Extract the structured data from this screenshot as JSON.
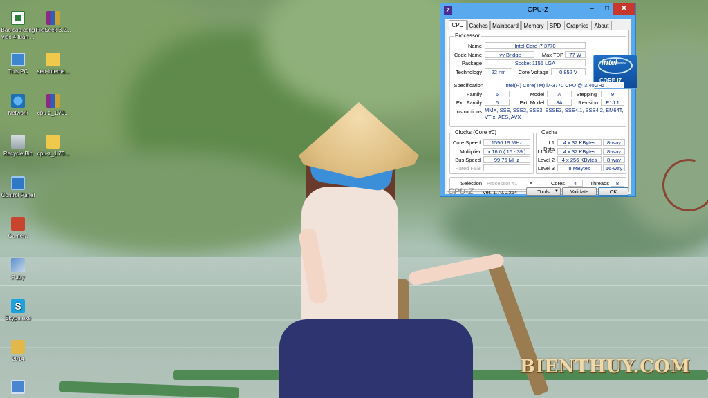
{
  "desktop": {
    "icons": [
      {
        "label": "Bao cao cong viec 4 tuan ...",
        "icon": "excel-document-icon"
      },
      {
        "label": "FileSeek 3.2...",
        "icon": "winrar-archive-icon"
      },
      {
        "label": "This PC",
        "icon": "this-pc-icon"
      },
      {
        "label": "seo-interna...",
        "icon": "folder-icon"
      },
      {
        "label": "Network",
        "icon": "network-icon"
      },
      {
        "label": "cpu-z_1.70...",
        "icon": "winrar-archive-icon"
      },
      {
        "label": "Recycle Bin",
        "icon": "recycle-bin-icon"
      },
      {
        "label": "cpu-z_1.70...",
        "icon": "folder-icon"
      },
      {
        "label": "Control Panel",
        "icon": "control-panel-icon"
      },
      {
        "label": "Camera",
        "icon": "camera-icon"
      },
      {
        "label": "Putty",
        "icon": "putty-icon"
      },
      {
        "label": "Skype.exe",
        "icon": "skype-icon"
      },
      {
        "label": "2014",
        "icon": "folder-icon"
      },
      {
        "label": "",
        "icon": "setup-icon"
      }
    ]
  },
  "wallpaper": {
    "watermark": "BIENTHUY.COM"
  },
  "cpuz": {
    "title": "CPU-Z",
    "app_icon": "Z",
    "window_buttons": {
      "minimize": "–",
      "maximize": "□",
      "close": "✕"
    },
    "tabs": [
      "CPU",
      "Caches",
      "Mainboard",
      "Memory",
      "SPD",
      "Graphics",
      "About"
    ],
    "active_tab": "CPU",
    "processor": {
      "group": "Processor",
      "name_label": "Name",
      "name": "Intel Core i7 3770",
      "codename_label": "Code Name",
      "codename": "Ivy Bridge",
      "max_tdp_label": "Max TDP",
      "max_tdp": "77 W",
      "package_label": "Package",
      "package": "Socket 1155 LGA",
      "technology_label": "Technology",
      "technology": "22 nm",
      "core_voltage_label": "Core Voltage",
      "core_voltage": "0.852 V",
      "specification_label": "Specification",
      "specification": "Intel(R) Core(TM) i7-3770 CPU @ 3.40GHz",
      "family_label": "Family",
      "family": "6",
      "model_label": "Model",
      "model": "A",
      "stepping_label": "Stepping",
      "stepping": "9",
      "ext_family_label": "Ext. Family",
      "ext_family": "6",
      "ext_model_label": "Ext. Model",
      "ext_model": "3A",
      "revision_label": "Revision",
      "revision": "E1/L1",
      "instructions_label": "Instructions",
      "instructions_line1": "MMX, SSE, SSE2, SSE3, SSSE3, SSE4.1, SSE4.2, EM64T,",
      "instructions_line2": "VT-x, AES, AVX"
    },
    "intel_badge": {
      "brand": "intel",
      "inside": "inside",
      "series": "CORE i7"
    },
    "clocks": {
      "group": "Clocks (Core #0)",
      "core_speed_label": "Core Speed",
      "core_speed": "1596.19 MHz",
      "multiplier_label": "Multiplier",
      "multiplier": "x 16.0 ( 16 - 39 )",
      "bus_speed_label": "Bus Speed",
      "bus_speed": "99.76 MHz",
      "rated_fsb_label": "Rated FSB",
      "rated_fsb": ""
    },
    "cache": {
      "group": "Cache",
      "l1d_label": "L1 Data",
      "l1d": "4 x 32 KBytes",
      "l1d_way": "8-way",
      "l1i_label": "L1 Inst.",
      "l1i": "4 x 32 KBytes",
      "l1i_way": "8-way",
      "l2_label": "Level 2",
      "l2": "4 x 256 KBytes",
      "l2_way": "8-way",
      "l3_label": "Level 3",
      "l3": "8 MBytes",
      "l3_way": "16-way"
    },
    "selection": {
      "label": "Selection",
      "value": "Processor #1",
      "cores_label": "Cores",
      "cores": "4",
      "threads_label": "Threads",
      "threads": "8"
    },
    "footer": {
      "logo": "CPU-Z",
      "version": "Ver. 1.70.0.x64",
      "tools": "Tools",
      "validate": "Validate",
      "ok": "OK"
    }
  }
}
